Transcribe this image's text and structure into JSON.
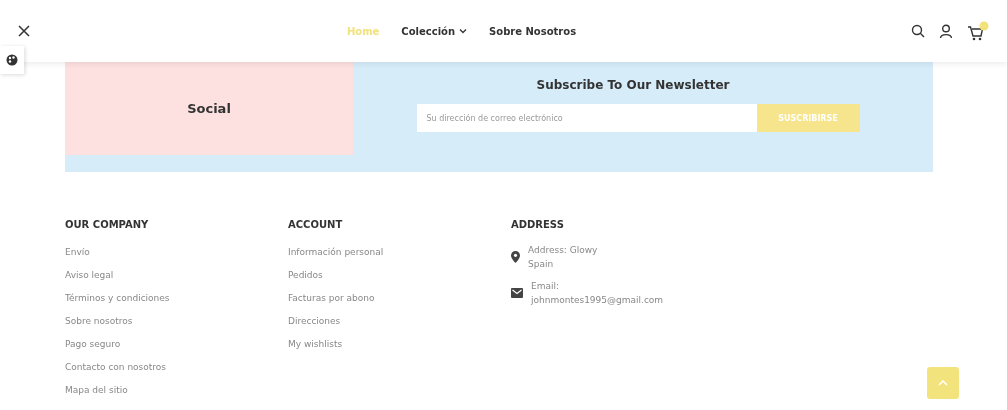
{
  "nav": [
    {
      "label": "Home",
      "selected": true,
      "dropdown": false
    },
    {
      "label": "Colección",
      "selected": false,
      "dropdown": true
    },
    {
      "label": "Sobre Nosotros",
      "selected": false,
      "dropdown": false
    }
  ],
  "social": {
    "title": "Social"
  },
  "newsletter": {
    "title": "Subscribe To Our Newsletter",
    "placeholder": "Su dirección de correo electrónico",
    "button": "SUSCRIBIRSE"
  },
  "columns": [
    {
      "title": "OUR COMPANY",
      "links": [
        "Envío",
        "Aviso legal",
        "Términos y condiciones",
        "Sobre nosotros",
        "Pago seguro",
        "Contacto con nosotros",
        "Mapa del sitio"
      ]
    },
    {
      "title": "ACCOUNT",
      "links": [
        "Información personal",
        "Pedidos",
        "Facturas por abono",
        "Direcciones",
        "My wishlists"
      ]
    }
  ],
  "address": {
    "title": "ADDRESS",
    "entries": [
      {
        "kind": "location",
        "lines": [
          "Address: Glowy",
          "Spain"
        ]
      },
      {
        "kind": "email",
        "lines": [
          "Email:",
          "johnmontes1995@gmail.com"
        ]
      }
    ]
  }
}
